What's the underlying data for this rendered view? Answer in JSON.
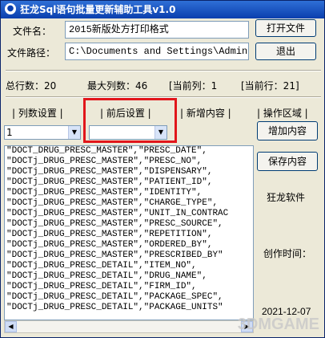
{
  "window": {
    "title": "狂龙Sql语句批量更新辅助工具v1.0"
  },
  "filename": {
    "label": "文件名：",
    "value": "2015新版处方打印格式"
  },
  "filepath": {
    "label": "文件路径：",
    "value": "C:\\Documents and Settings\\Adminis"
  },
  "buttons": {
    "open_file": "打开文件",
    "exit": "退出",
    "add_content": "增加内容",
    "save_content": "保存内容"
  },
  "stats": {
    "total_rows": "总行数：20",
    "max_cols": "最大列数：46",
    "current_col": "[当前列：1",
    "current_row": "[当前行：21]"
  },
  "sections": {
    "col_settings": "| 列数设置 |",
    "before_after": "| 前后设置 |",
    "new_content": "| 新增内容 |",
    "ops_area": "| 操作区域 |"
  },
  "combos": {
    "col_value": "1",
    "prefix_value": ""
  },
  "list_rows": [
    "\"DOCT_DRUG_PRESC_MASTER\",\"PRESC_DATE\",",
    "\"DOCTj_DRUG_PRESC_MASTER\",\"PRESC_NO\",",
    "\"DOCTj_DRUG_PRESC_MASTER\",\"DISPENSARY\",",
    "\"DOCTj_DRUG_PRESC_MASTER\",\"PATIENT_ID\",",
    "\"DOCTj_DRUG_PRESC_MASTER\",\"IDENTITY\",",
    "\"DOCTj_DRUG_PRESC_MASTER\",\"CHARGE_TYPE\",",
    "\"DOCTj_DRUG_PRESC_MASTER\",\"UNIT_IN_CONTRAC",
    "\"DOCTj_DRUG_PRESC_MASTER\",\"PRESC_SOURCE\",",
    "\"DOCTj_DRUG_PRESC_MASTER\",\"REPETITION\",",
    "\"DOCTj_DRUG_PRESC_MASTER\",\"ORDERED_BY\",",
    "\"DOCTj_DRUG_PRESC_MASTER\",\"PRESCRIBED_BY\"",
    "\"DOCTj_DRUG_PRESC_DETAIL\",\"ITEM_NO\",",
    "\"DOCTj_DRUG_PRESC_DETAIL\",\"DRUG_NAME\",",
    "\"DOCTj_DRUG_PRESC_DETAIL\",\"FIRM_ID\",",
    "\"DOCTj_DRUG_PRESC_DETAIL\",\"PACKAGE_SPEC\",",
    "\"DOCTj_DRUG_PRESC_DETAIL\",\"PACKAGE_UNITS\""
  ],
  "side": {
    "brand": "狂龙软件",
    "created_label": "创作时间：",
    "date": "2021-12-07"
  },
  "watermark": "3DMGAME"
}
